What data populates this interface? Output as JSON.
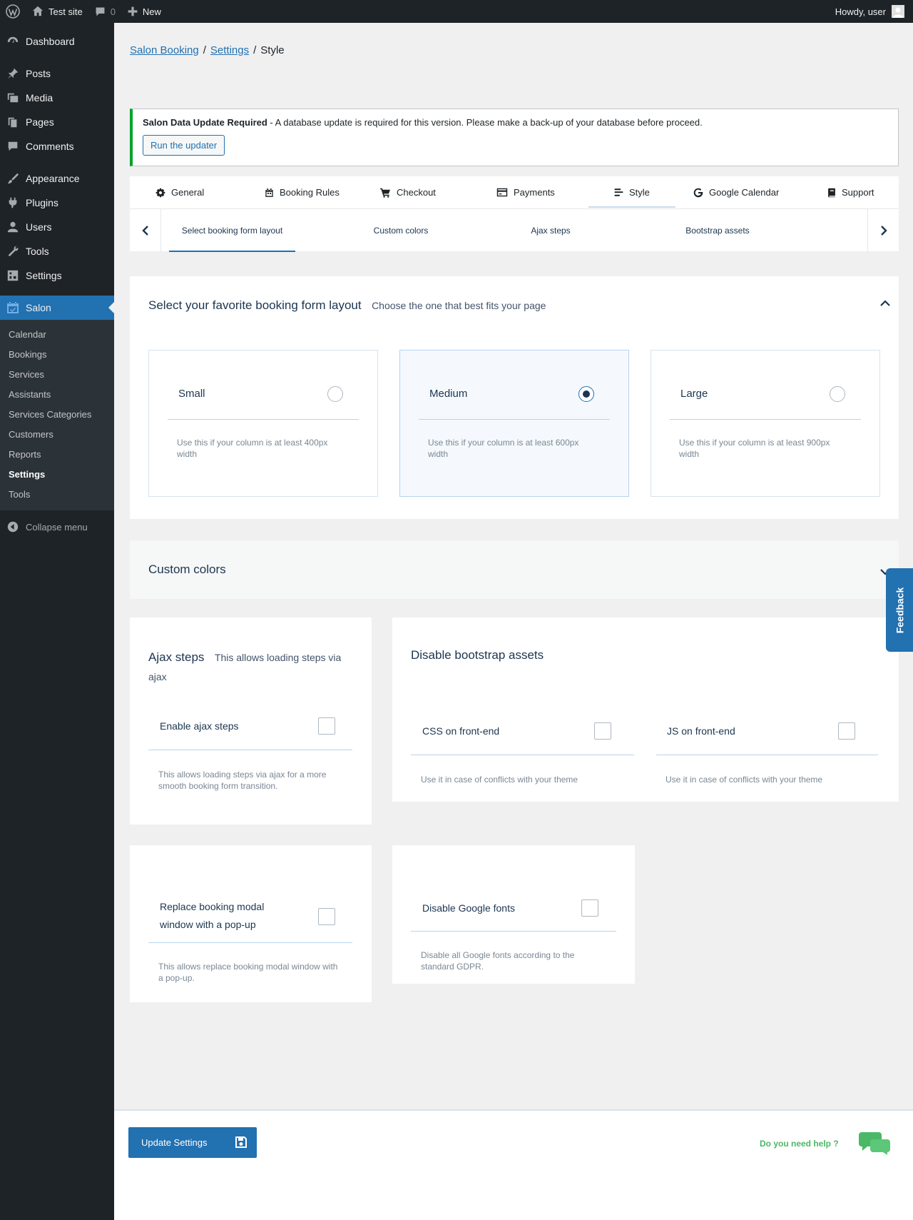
{
  "adminbar": {
    "site_name": "Test site",
    "comments_count": "0",
    "new_label": "New",
    "howdy": "Howdy, user"
  },
  "sidebar": {
    "items": [
      {
        "label": "Dashboard",
        "icon": "dashboard-icon"
      },
      {
        "label": "Posts",
        "icon": "pin-icon"
      },
      {
        "label": "Media",
        "icon": "media-icon"
      },
      {
        "label": "Pages",
        "icon": "pages-icon"
      },
      {
        "label": "Comments",
        "icon": "comment-icon"
      },
      {
        "label": "Appearance",
        "icon": "brush-icon"
      },
      {
        "label": "Plugins",
        "icon": "plugin-icon"
      },
      {
        "label": "Users",
        "icon": "user-icon"
      },
      {
        "label": "Tools",
        "icon": "wrench-icon"
      },
      {
        "label": "Settings",
        "icon": "settings-icon"
      },
      {
        "label": "Salon",
        "icon": "calendar-icon"
      }
    ],
    "submenu": [
      "Calendar",
      "Bookings",
      "Services",
      "Assistants",
      "Services Categories",
      "Customers",
      "Reports",
      "Settings",
      "Tools"
    ],
    "active_submenu": "Settings",
    "collapse": "Collapse menu"
  },
  "breadcrumb": {
    "link1": "Salon Booking",
    "link2": "Settings",
    "current": "Style",
    "sep": "/"
  },
  "notice": {
    "title": "Salon Data Update Required",
    "message": " - A database update is required for this version. Please make a back-up of your database before proceed.",
    "button": "Run the updater",
    "accent": "#00a32a"
  },
  "tabs": [
    {
      "label": "General",
      "icon": "gear-icon"
    },
    {
      "label": "Booking Rules",
      "icon": "calendar-icon"
    },
    {
      "label": "Checkout",
      "icon": "cart-icon"
    },
    {
      "label": "Payments",
      "icon": "credit-card-icon"
    },
    {
      "label": "Style",
      "icon": "align-left-icon"
    },
    {
      "label": "Google Calendar",
      "icon": "google-icon"
    },
    {
      "label": "Support",
      "icon": "book-icon"
    }
  ],
  "active_tab": "Style",
  "subtabs": [
    "Select booking form layout",
    "Custom colors",
    "Ajax steps",
    "Bootstrap assets"
  ],
  "active_subtab": "Select booking form layout",
  "layout_section": {
    "title": "Select your favorite booking form layout",
    "subtitle": "Choose the one that best fits your page",
    "options": [
      {
        "title": "Small",
        "desc": "Use this if your column is at least 400px width",
        "selected": false
      },
      {
        "title": "Medium",
        "desc": "Use this if your column is at least 600px width",
        "selected": true
      },
      {
        "title": "Large",
        "desc": "Use this if your column is at least 900px width",
        "selected": false
      }
    ]
  },
  "custom_colors": {
    "title": "Custom colors"
  },
  "ajax": {
    "title": "Ajax steps",
    "subtitle": "This allows loading steps via ajax",
    "option": "Enable ajax steps",
    "desc": "This allows loading steps via ajax for a more smooth booking form transition."
  },
  "bootstrap": {
    "title": "Disable bootstrap assets",
    "css_label": "CSS on front-end",
    "css_desc": "Use it in case of conflicts with your theme",
    "js_label": "JS on front-end",
    "js_desc": "Use it in case of conflicts with your theme"
  },
  "modal": {
    "label": "Replace booking modal window with a pop-up",
    "desc": "This allows replace booking modal window with a pop-up."
  },
  "fonts": {
    "label": "Disable Google fonts",
    "desc": "Disable all Google fonts according to the standard GDPR."
  },
  "feedback": "Feedback",
  "footer": {
    "update_button": "Update Settings",
    "help": "Do you need help ?"
  },
  "colors": {
    "primary": "#2271b1",
    "help_green": "#4ab866",
    "admin_dark": "#1d2327"
  }
}
